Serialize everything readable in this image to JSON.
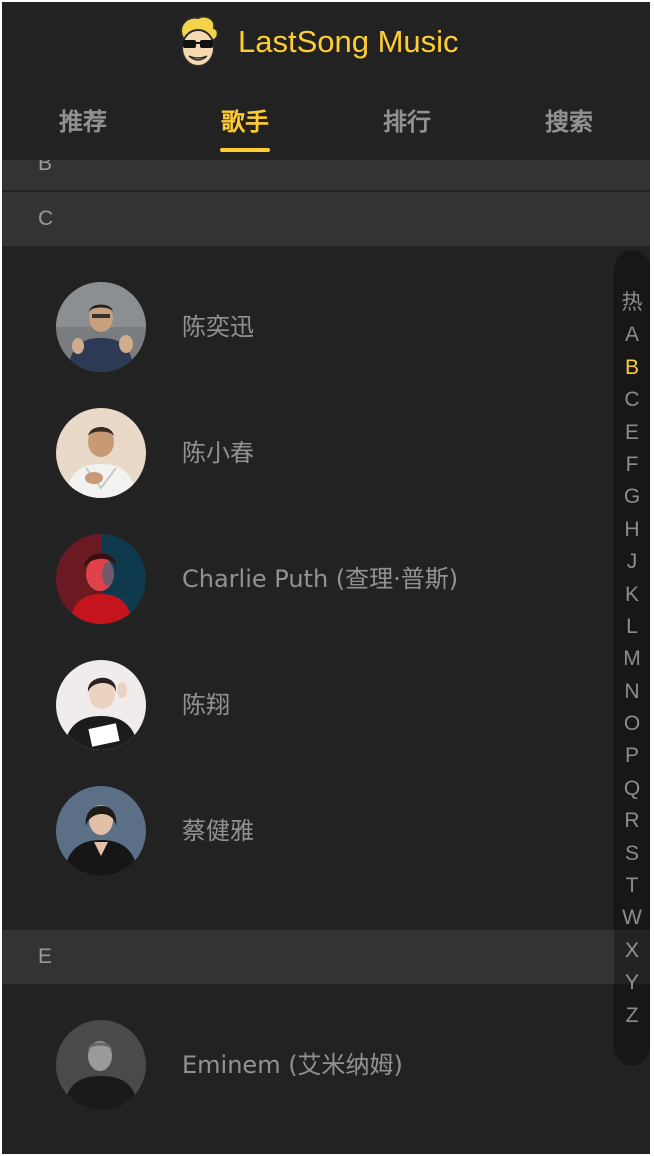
{
  "app": {
    "title": "LastSong Music",
    "accent_color": "#ffcd32",
    "logo_icon": "cartoon-mascot-sunglasses"
  },
  "tabs": [
    {
      "label": "推荐",
      "active": false
    },
    {
      "label": "歌手",
      "active": true
    },
    {
      "label": "排行",
      "active": false
    },
    {
      "label": "搜索",
      "active": false
    }
  ],
  "groups": {
    "b": {
      "title": "B"
    },
    "c": {
      "title": "C",
      "singers": [
        {
          "name": "陈奕迅"
        },
        {
          "name": "陈小春"
        },
        {
          "name": "Charlie Puth (查理·普斯)"
        },
        {
          "name": "陈翔"
        },
        {
          "name": "蔡健雅"
        }
      ]
    },
    "e": {
      "title": "E",
      "singers": [
        {
          "name": "Eminem (艾米纳姆)"
        }
      ]
    }
  },
  "index_bar": {
    "items": [
      "热",
      "A",
      "B",
      "C",
      "E",
      "F",
      "G",
      "H",
      "J",
      "K",
      "L",
      "M",
      "N",
      "O",
      "P",
      "Q",
      "R",
      "S",
      "T",
      "W",
      "X",
      "Y",
      "Z"
    ],
    "current": "B"
  }
}
